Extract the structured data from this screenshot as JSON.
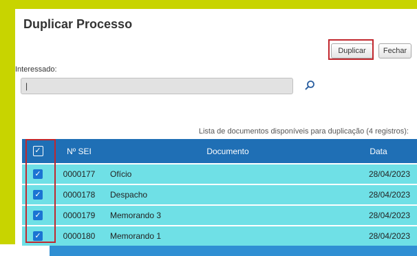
{
  "title": "Duplicar Processo",
  "buttons": {
    "duplicar": "Duplicar",
    "fechar": "Fechar"
  },
  "interessado": {
    "label": "Interessado:",
    "value": "|"
  },
  "icons": {
    "search": "search-icon",
    "checkbox": "checkbox-checked-icon"
  },
  "colors": {
    "header_bg": "#1f6fb5",
    "row_bg": "#6fe0e6",
    "highlight": "#c1272d",
    "frame": "#c8d400"
  },
  "table": {
    "caption": "Lista de documentos disponíveis para duplicação (4 registros):",
    "headers": {
      "sei": "Nº SEI",
      "documento": "Documento",
      "data": "Data"
    },
    "rows": [
      {
        "sei": "0000177",
        "documento": "Ofício",
        "data": "28/04/2023",
        "checked": true
      },
      {
        "sei": "0000178",
        "documento": "Despacho",
        "data": "28/04/2023",
        "checked": true
      },
      {
        "sei": "0000179",
        "documento": "Memorando 3",
        "data": "28/04/2023",
        "checked": true
      },
      {
        "sei": "0000180",
        "documento": "Memorando 1",
        "data": "28/04/2023",
        "checked": true
      }
    ]
  }
}
